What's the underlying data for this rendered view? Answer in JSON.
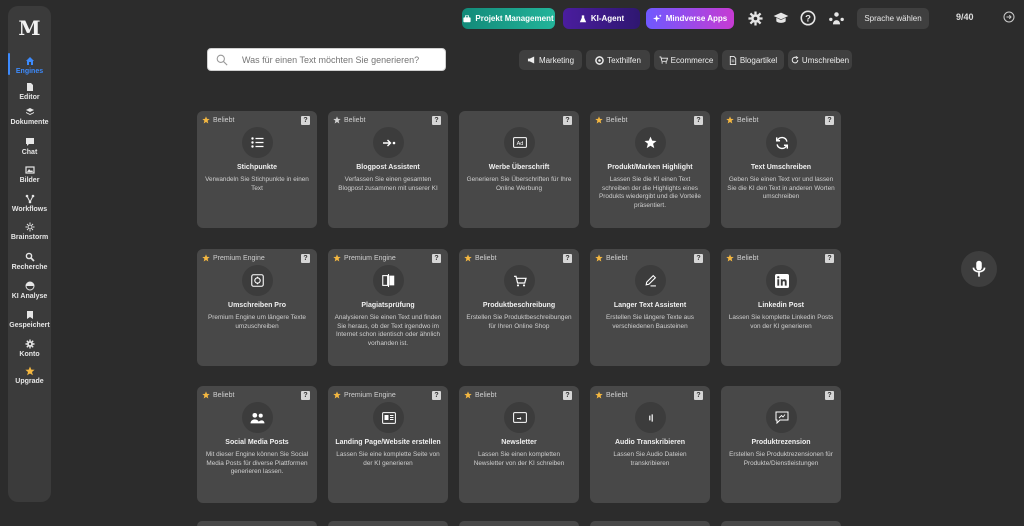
{
  "sidebar": {
    "logo": "M",
    "items": [
      {
        "label": "Engines",
        "icon": "home-icon"
      },
      {
        "label": "Editor",
        "icon": "document-icon"
      },
      {
        "label": "Dokumente",
        "icon": "layers-icon"
      },
      {
        "label": "Chat",
        "icon": "chat-icon"
      },
      {
        "label": "Bilder",
        "icon": "image-icon"
      },
      {
        "label": "Workflows",
        "icon": "workflow-icon"
      },
      {
        "label": "Brainstorm",
        "icon": "sun-icon"
      },
      {
        "label": "Recherche",
        "icon": "search-icon"
      },
      {
        "label": "KI Analyse",
        "icon": "analysis-icon"
      },
      {
        "label": "Gespeichert",
        "icon": "bookmark-icon"
      },
      {
        "label": "Konto",
        "icon": "gear-icon"
      },
      {
        "label": "Upgrade",
        "icon": "star-icon"
      }
    ],
    "active_color": "#3d8bfd"
  },
  "topbar": {
    "projekt_management": "Projekt Management",
    "ki_agent": "KI-Agent",
    "mindverse_apps": "Mindverse Apps",
    "language": "Sprache wählen",
    "counter": "9/40"
  },
  "search": {
    "placeholder": "Was für einen Text möchten Sie generieren?"
  },
  "filters": [
    "Marketing",
    "Texthilfen",
    "Ecommerce",
    "Blogartikel",
    "Umschreiben"
  ],
  "cards": [
    {
      "badge": "Beliebt",
      "icon": "list-icon",
      "title": "Stichpunkte",
      "desc": "Verwandeln Sie Stichpunkte in einen Text"
    },
    {
      "badge": "Beliebt",
      "icon": "arrow-dot-icon",
      "title": "Blogpost Assistent",
      "desc": "Verfassen Sie einen gesamten Blogpost zusammen mit unserer KI"
    },
    {
      "badge": "",
      "icon": "ad-icon",
      "title": "Werbe Überschrift",
      "desc": "Generieren Sie Überschriften für Ihre Online Werbung"
    },
    {
      "badge": "Beliebt",
      "icon": "star-icon",
      "title": "Produkt/Marken Highlight",
      "desc": "Lassen Sie die KI einen Text schreiben der die Highlights eines Produkts wiedergibt und die Vorteile präsentiert."
    },
    {
      "badge": "Beliebt",
      "icon": "refresh-icon",
      "title": "Text Umschreiben",
      "desc": "Geben Sie einen Text vor und lassen Sie die KI den Text in anderen Worten umschreiben"
    },
    {
      "badge": "Premium Engine",
      "icon": "rewrite-icon",
      "title": "Umschreiben Pro",
      "desc": "Premium Engine um längere Texte umzuschreiben"
    },
    {
      "badge": "Premium Engine",
      "icon": "compare-icon",
      "title": "Plagiatsprüfung",
      "desc": "Analysieren Sie einen Text und finden Sie heraus, ob der Text irgendwo im Internet schon identisch oder ähnlich vorhanden ist."
    },
    {
      "badge": "Beliebt",
      "icon": "cart-icon",
      "title": "Produktbeschreibung",
      "desc": "Erstellen Sie Produktbeschreibungen für Ihren Online Shop"
    },
    {
      "badge": "Beliebt",
      "icon": "pen-icon",
      "title": "Langer Text Assistent",
      "desc": "Erstellen Sie längere Texte aus verschiedenen Bausteinen"
    },
    {
      "badge": "Beliebt",
      "icon": "linkedin-icon",
      "title": "Linkedin Post",
      "desc": "Lassen Sie komplette Linkedin Posts von der KI generieren"
    },
    {
      "badge": "Beliebt",
      "icon": "people-icon",
      "title": "Social Media Posts",
      "desc": "Mit dieser Engine können Sie Social Media Posts für diverse Plattformen generieren lassen."
    },
    {
      "badge": "Premium Engine",
      "icon": "landing-page-icon",
      "title": "Landing Page/Website erstellen",
      "desc": "Lassen Sie eine komplette Seite von der KI generieren"
    },
    {
      "badge": "Beliebt",
      "icon": "newsletter-icon",
      "title": "Newsletter",
      "desc": "Lassen Sie einen kompletten Newsletter von der KI schreiben"
    },
    {
      "badge": "Beliebt",
      "icon": "audio-icon",
      "title": "Audio Transkribieren",
      "desc": "Lassen Sie Audio Dateien transkribieren"
    },
    {
      "badge": "",
      "icon": "review-icon",
      "title": "Produktrezension",
      "desc": "Erstellen Sie Produktrezensionen für Produkte/Dienstleistungen"
    }
  ],
  "colors": {
    "badge_star": "#f4b740",
    "background": "#2c2c2c",
    "card": "#484848"
  }
}
